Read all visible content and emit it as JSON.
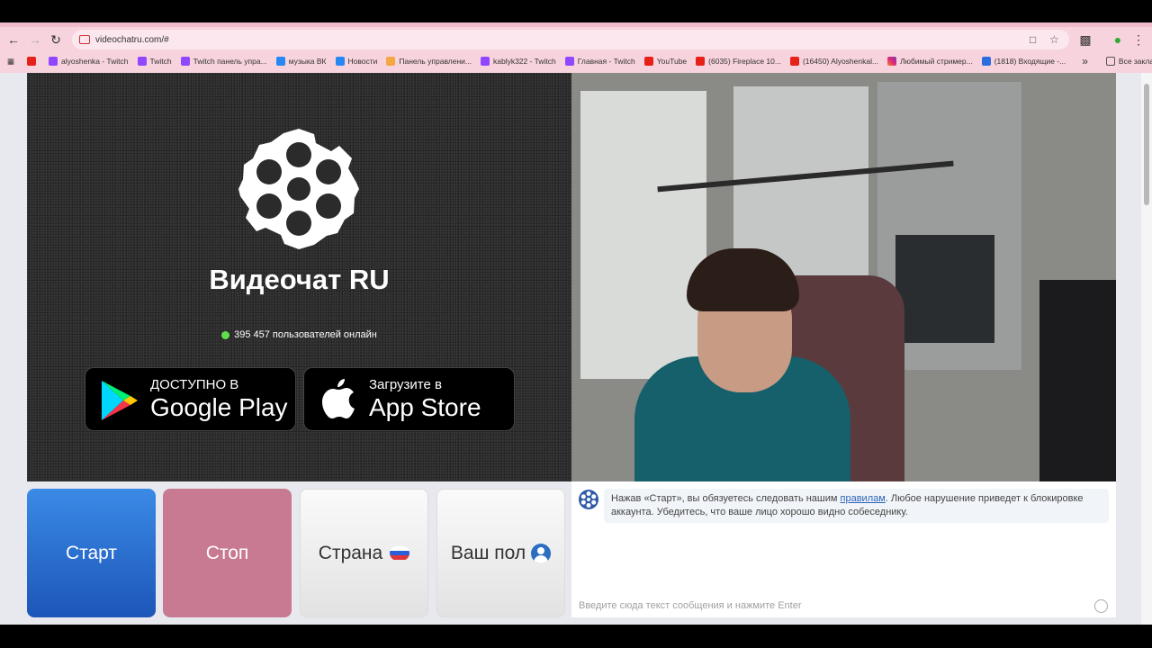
{
  "browser": {
    "url": "videochatru.com/#",
    "bookmarks": [
      {
        "label": "",
        "icon": "youtube-icon"
      },
      {
        "label": "alyoshenka - Twitch",
        "icon": "twitch-icon"
      },
      {
        "label": "Twitch",
        "icon": "twitch-icon"
      },
      {
        "label": "Twitch панель упра...",
        "icon": "twitch-icon"
      },
      {
        "label": "музыка ВК",
        "icon": "vk-icon"
      },
      {
        "label": "Новости",
        "icon": "vk-icon"
      },
      {
        "label": "Панель управлени...",
        "icon": "panel-icon"
      },
      {
        "label": "kablyk322 - Twitch",
        "icon": "twitch-icon"
      },
      {
        "label": "Главная - Twitch",
        "icon": "twitch-icon"
      },
      {
        "label": "YouTube",
        "icon": "youtube-icon"
      },
      {
        "label": "(6035) Fireplace 10...",
        "icon": "youtube-icon"
      },
      {
        "label": "(16450) Alyoshenkal...",
        "icon": "youtube-icon"
      },
      {
        "label": "Любимый стример...",
        "icon": "instagram-icon"
      },
      {
        "label": "(1818) Входящие -...",
        "icon": "mail-icon"
      }
    ],
    "bookmarks_more": "»",
    "all_bookmarks": "Все закладки"
  },
  "promo": {
    "brand": "Видеочат RU",
    "online_text": "395 457 пользователей онлайн",
    "google_play_small": "ДОСТУПНО В",
    "google_play_big": "Google Play",
    "app_store_small": "Загрузите в",
    "app_store_big": "App Store"
  },
  "controls": {
    "start_label": "Старт",
    "stop_label": "Стоп",
    "country_label": "Страна",
    "gender_label": "Ваш пол"
  },
  "chat": {
    "notice_before": "Нажав «Старт», вы обязуетесь следовать нашим ",
    "notice_link": "правилам",
    "notice_after": ". Любое нарушение приведет к блокировке аккаунта. Убедитесь, что ваше лицо хорошо видно собеседнику.",
    "input_placeholder": "Введите сюда текст сообщения и нажмите Enter"
  },
  "colors": {
    "start": "#2a6fd0",
    "stop": "#c87a93",
    "chrome": "#f7d3dd",
    "online_dot": "#5fe04a"
  }
}
